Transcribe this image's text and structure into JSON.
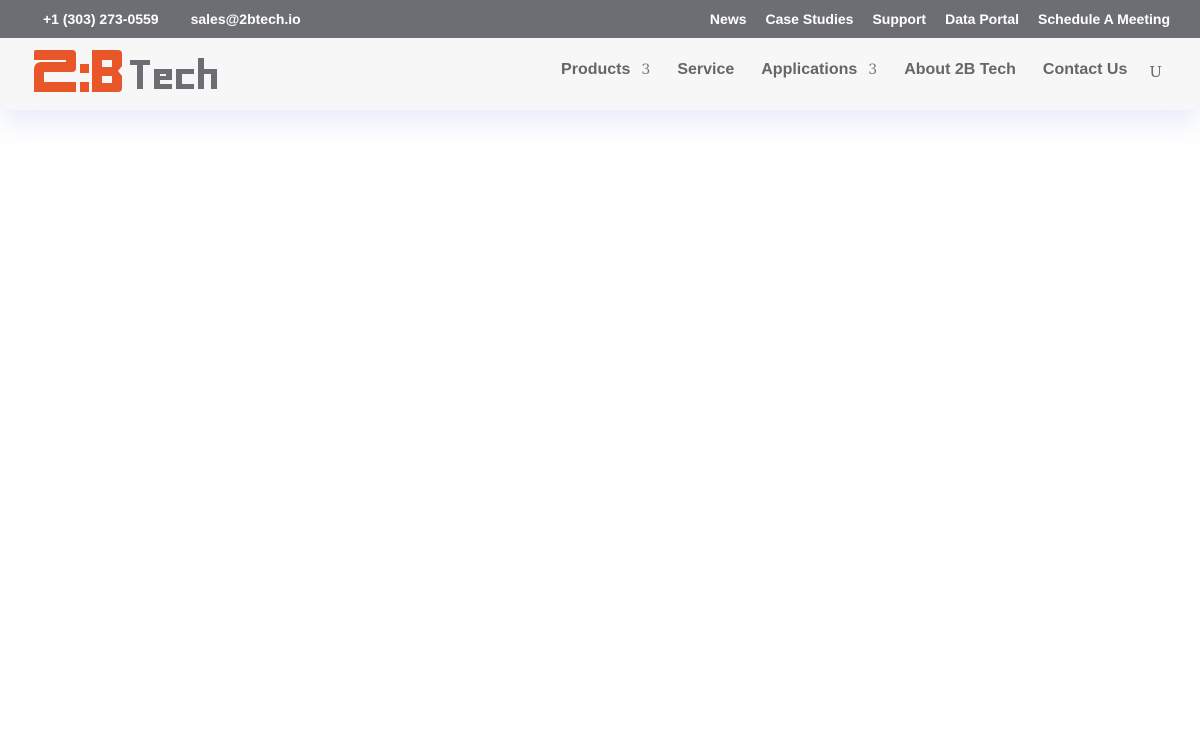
{
  "topbar": {
    "phone": "+1 (303) 273-0559",
    "email": "sales@2btech.io",
    "links": [
      "News",
      "Case Studies",
      "Support",
      "Data Portal",
      "Schedule A Meeting"
    ]
  },
  "header": {
    "logo": {
      "text_primary": "2B",
      "text_secondary": "Tech",
      "colors": {
        "primary": "#e8562a",
        "secondary": "#6d6e73"
      }
    },
    "nav": [
      {
        "label": "Products",
        "caret": "3"
      },
      {
        "label": "Service"
      },
      {
        "label": "Applications",
        "caret": "3"
      },
      {
        "label": "About 2B Tech"
      },
      {
        "label": "Contact Us"
      }
    ],
    "search_glyph": "U"
  },
  "colors": {
    "topbar_bg": "#6d6e73",
    "header_bg": "#f7f7f7",
    "nav_text": "#666666",
    "brand_orange": "#e8562a"
  }
}
